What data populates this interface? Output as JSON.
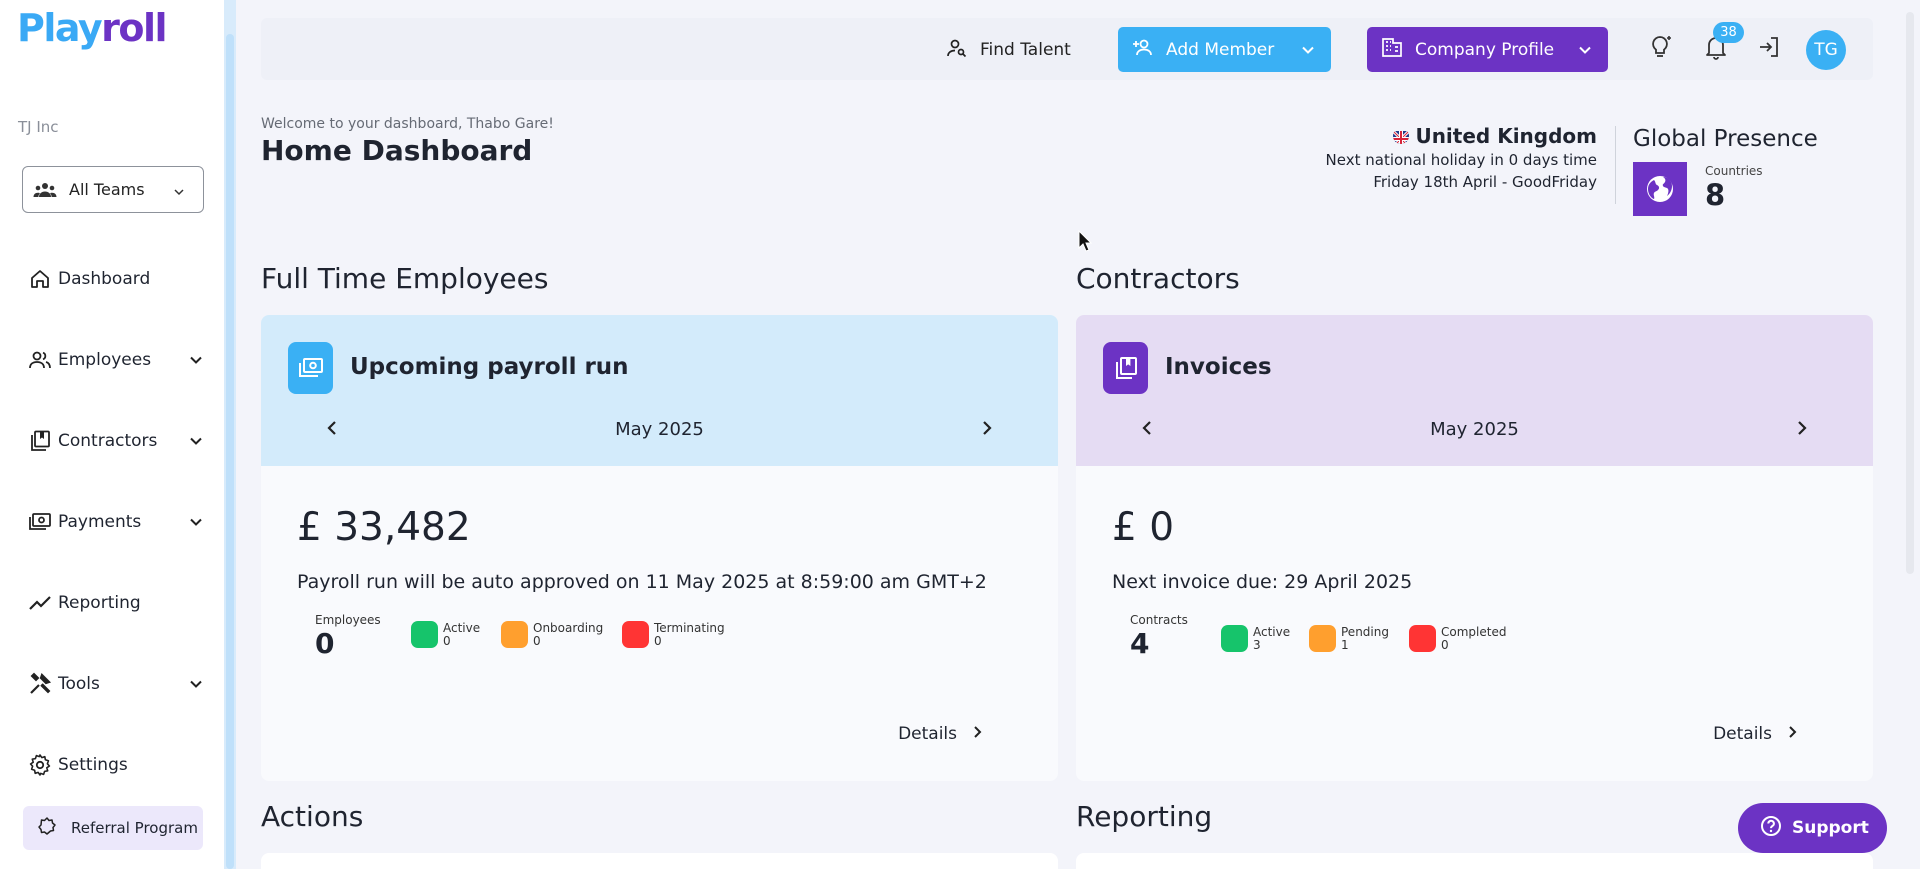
{
  "app": {
    "logo_part1": "Play",
    "logo_part2": "roll"
  },
  "sidebar": {
    "company": "TJ Inc",
    "team_select": "All Teams",
    "items": [
      {
        "label": "Dashboard",
        "icon": "home-icon"
      },
      {
        "label": "Employees",
        "icon": "people-icon"
      },
      {
        "label": "Contractors",
        "icon": "contracts-icon"
      },
      {
        "label": "Payments",
        "icon": "money-icon"
      },
      {
        "label": "Reporting",
        "icon": "trend-icon"
      },
      {
        "label": "Tools",
        "icon": "tools-icon"
      },
      {
        "label": "Settings",
        "icon": "gear-icon"
      }
    ],
    "referral": "Referral Program"
  },
  "topbar": {
    "find_talent": "Find Talent",
    "add_member": "Add Member",
    "company_profile": "Company Profile",
    "notifications_count": "38",
    "avatar_initials": "TG"
  },
  "header": {
    "welcome": "Welcome to your dashboard, Thabo Gare!",
    "title": "Home Dashboard",
    "country": "United Kingdom",
    "holiday_line1": "Next national holiday in 0 days time",
    "holiday_line2": "Friday 18th April - GoodFriday",
    "global_presence_title": "Global Presence",
    "countries_label": "Countries",
    "countries_value": "8"
  },
  "sections": {
    "fte": "Full Time Employees",
    "contractors": "Contractors",
    "actions": "Actions",
    "reporting": "Reporting"
  },
  "payroll_card": {
    "title": "Upcoming payroll run",
    "month": "May 2025",
    "amount": "£ 33,482",
    "subtext": "Payroll run will be auto approved on 11 May 2025 at 8:59:00 am GMT+2",
    "count_label": "Employees",
    "count_value": "0",
    "legend": [
      {
        "label": "Active",
        "value": "0",
        "color": "#16c46b"
      },
      {
        "label": "Onboarding",
        "value": "0",
        "color": "#ff9f2e"
      },
      {
        "label": "Terminating",
        "value": "0",
        "color": "#ff3434"
      }
    ],
    "details": "Details",
    "head_color": "#d3ebfb",
    "icon_color": "#3ab0f4"
  },
  "invoice_card": {
    "title": "Invoices",
    "month": "May 2025",
    "amount": "£ 0",
    "subtext": "Next invoice due: 29 April 2025",
    "count_label": "Contracts",
    "count_value": "4",
    "legend": [
      {
        "label": "Active",
        "value": "3",
        "color": "#16c46b"
      },
      {
        "label": "Pending",
        "value": "1",
        "color": "#ff9f2e"
      },
      {
        "label": "Completed",
        "value": "0",
        "color": "#ff3434"
      }
    ],
    "details": "Details",
    "head_color": "#e5dcf3",
    "icon_color": "#6c33c4"
  },
  "support": {
    "label": "Support"
  }
}
